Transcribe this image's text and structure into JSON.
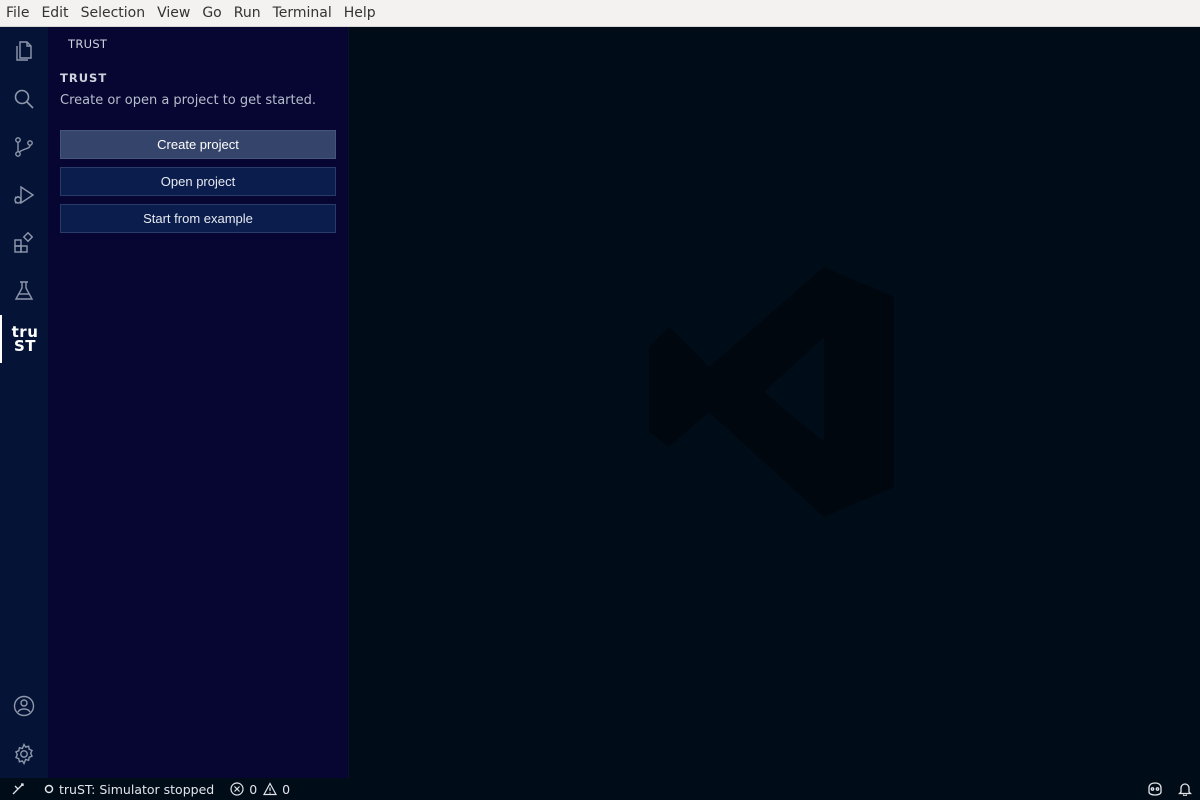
{
  "menubar": {
    "items": [
      "File",
      "Edit",
      "Selection",
      "View",
      "Go",
      "Run",
      "Terminal",
      "Help"
    ]
  },
  "activitybar": {
    "items": [
      "explorer-icon",
      "search-icon",
      "source-control-icon",
      "run-debug-icon",
      "extensions-icon",
      "testing-icon",
      "trust-icon"
    ],
    "trust_logo_top": "tru",
    "trust_logo_bottom": "ST",
    "bottom_items": [
      "account-icon",
      "gear-icon"
    ]
  },
  "sidebar": {
    "panel_title": "TRUST",
    "section_title": "TRUST",
    "intro": "Create or open a project to get started.",
    "buttons": {
      "create": "Create project",
      "open": "Open project",
      "example": "Start from example"
    }
  },
  "statusbar": {
    "simulator": "truST: Simulator stopped",
    "errors": "0",
    "warnings": "0"
  },
  "colors": {
    "activity_bar": "#051336",
    "sidebar": "#070531",
    "editor": "#000c18",
    "primary_button": "#35446a",
    "secondary_button": "#0b1d4d"
  }
}
